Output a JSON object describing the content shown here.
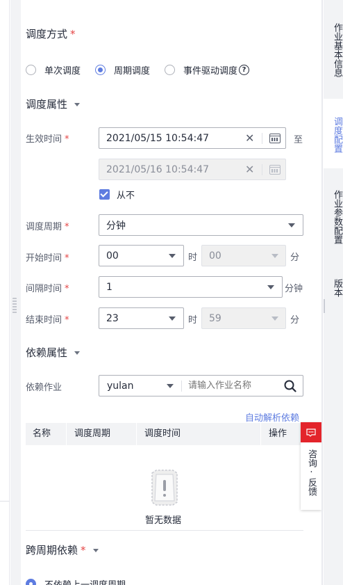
{
  "schedule_mode": {
    "label": "调度方式",
    "required_mark": "*",
    "options": [
      {
        "label": "单次调度",
        "selected": false
      },
      {
        "label": "周期调度",
        "selected": true
      },
      {
        "label": "事件驱动调度",
        "selected": false
      }
    ],
    "help_glyph": "?"
  },
  "schedule_props": {
    "title": "调度属性",
    "effective_time_label": "生效时间",
    "start_datetime": "2021/05/15 10:54:47",
    "to_text": "至",
    "end_datetime": "2021/05/16 10:54:47",
    "never_label": "从不",
    "never_checked": true,
    "period_label": "调度周期",
    "period_value": "分钟",
    "start_time_label": "开始时间",
    "start_hour": "00",
    "start_minute": "00",
    "interval_label": "间隔时间",
    "interval_value": "1",
    "interval_unit": "分钟",
    "end_time_label": "结束时间",
    "end_hour": "23",
    "end_minute": "59",
    "hour_unit": "时",
    "minute_unit": "分",
    "clear_glyph": "✕"
  },
  "dependency": {
    "title": "依赖属性",
    "job_label": "依赖作业",
    "project_value": "yulan",
    "job_placeholder": "请输入作业名称",
    "auto_parse_link": "自动解析依赖",
    "columns": [
      "名称",
      "调度周期",
      "调度时间",
      "操作"
    ],
    "empty_text": "暂无数据"
  },
  "cross_period": {
    "title": "跨周期依赖",
    "required_mark": "*",
    "option_label": "不依赖上一调度周期"
  },
  "right_nav": {
    "items": [
      {
        "label": "作业基本信息",
        "active": false
      },
      {
        "label": "调度配置",
        "active": true
      },
      {
        "label": "作业参数配置",
        "active": false
      },
      {
        "label": "版本",
        "active": false
      }
    ]
  },
  "consult_widget": {
    "label": "咨询·反馈"
  },
  "colors": {
    "accent": "#5e7ce0",
    "required": "#e54545",
    "consult": "#e3242b"
  }
}
